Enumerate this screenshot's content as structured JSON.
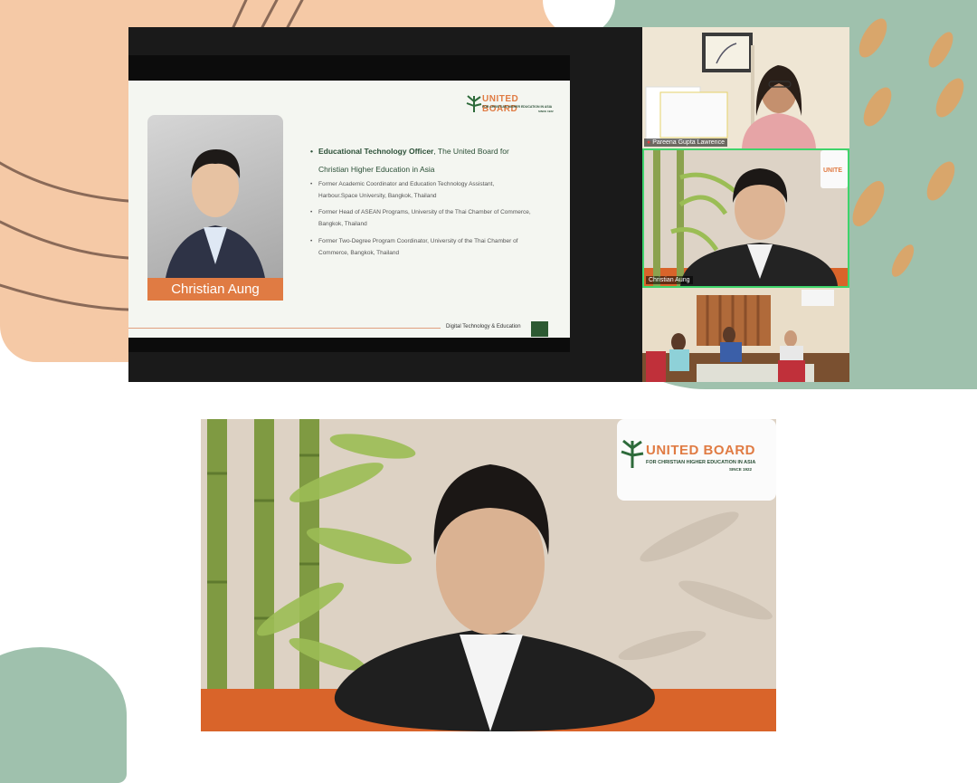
{
  "slide": {
    "person_name": "Christian Aung",
    "logo": {
      "name": "UNITED BOARD",
      "subtitle": "FOR CHRISTIAN HIGHER EDUCATION IN ASIA",
      "since": "SINCE 1922"
    },
    "title_bold": "Educational Technology Officer",
    "title_rest": ", The United Board for",
    "title_line2": "Christian Higher Education in Asia",
    "bullets": [
      [
        "Former Academic Coordinator and Education Technology Assistant,",
        "Harbour.Space University, Bangkok, Thailand"
      ],
      [
        "Former Head of ASEAN Programs, University of the Thai Chamber of Commerce,",
        "Bangkok, Thailand"
      ],
      [
        "Former Two-Degree Program Coordinator, University of the Thai Chamber of",
        "Commerce, Bangkok, Thailand"
      ]
    ],
    "footer": "Digital Technology & Education"
  },
  "participants": [
    {
      "name": "Pareena Gupta Lawrence",
      "muted": true
    },
    {
      "name": "Christian Aung",
      "active": true
    },
    {
      "name": ""
    }
  ],
  "speaker_logo": {
    "name": "UNITED BOARD",
    "subtitle": "FOR CHRISTIAN HIGHER EDUCATION IN ASIA",
    "since": "SINCE 1922"
  },
  "colors": {
    "accent_orange": "#e07b43",
    "brand_green": "#2d5a33",
    "active_border": "#3fd46b"
  }
}
